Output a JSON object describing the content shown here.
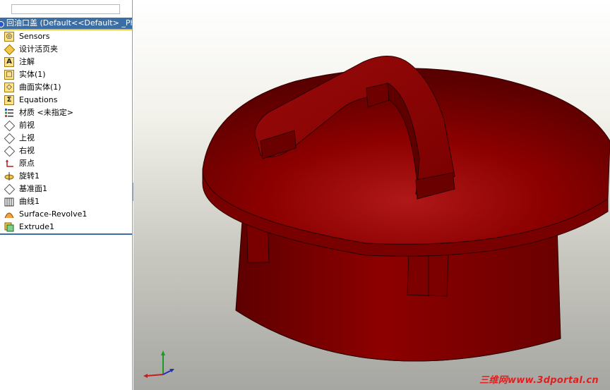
{
  "feature_tree": {
    "root": "回油口盖 (Default<<Default> _Phot",
    "items": [
      {
        "label": "Sensors",
        "icon": "sensor-icon"
      },
      {
        "label": "设计活页夹",
        "icon": "design-binder-icon"
      },
      {
        "label": "注解",
        "icon": "annotations-icon"
      },
      {
        "label": "实体(1)",
        "icon": "solid-bodies-icon"
      },
      {
        "label": "曲面实体(1)",
        "icon": "surface-bodies-icon"
      },
      {
        "label": "Equations",
        "icon": "equations-icon"
      },
      {
        "label": "材质 <未指定>",
        "icon": "material-icon"
      },
      {
        "label": "前视",
        "icon": "plane-icon"
      },
      {
        "label": "上视",
        "icon": "plane-icon"
      },
      {
        "label": "右视",
        "icon": "plane-icon"
      },
      {
        "label": "原点",
        "icon": "origin-icon"
      },
      {
        "label": "旋转1",
        "icon": "revolve-icon"
      },
      {
        "label": "基准面1",
        "icon": "plane-icon"
      },
      {
        "label": "曲线1",
        "icon": "curve-icon"
      },
      {
        "label": "Surface-Revolve1",
        "icon": "surface-revolve-icon"
      },
      {
        "label": "Extrude1",
        "icon": "extrude-icon"
      }
    ]
  },
  "viewport": {
    "model_color": "#8b0000",
    "triad_axes": [
      "X",
      "Y",
      "Z"
    ]
  },
  "watermark": "三维网www.3dportal.cn"
}
